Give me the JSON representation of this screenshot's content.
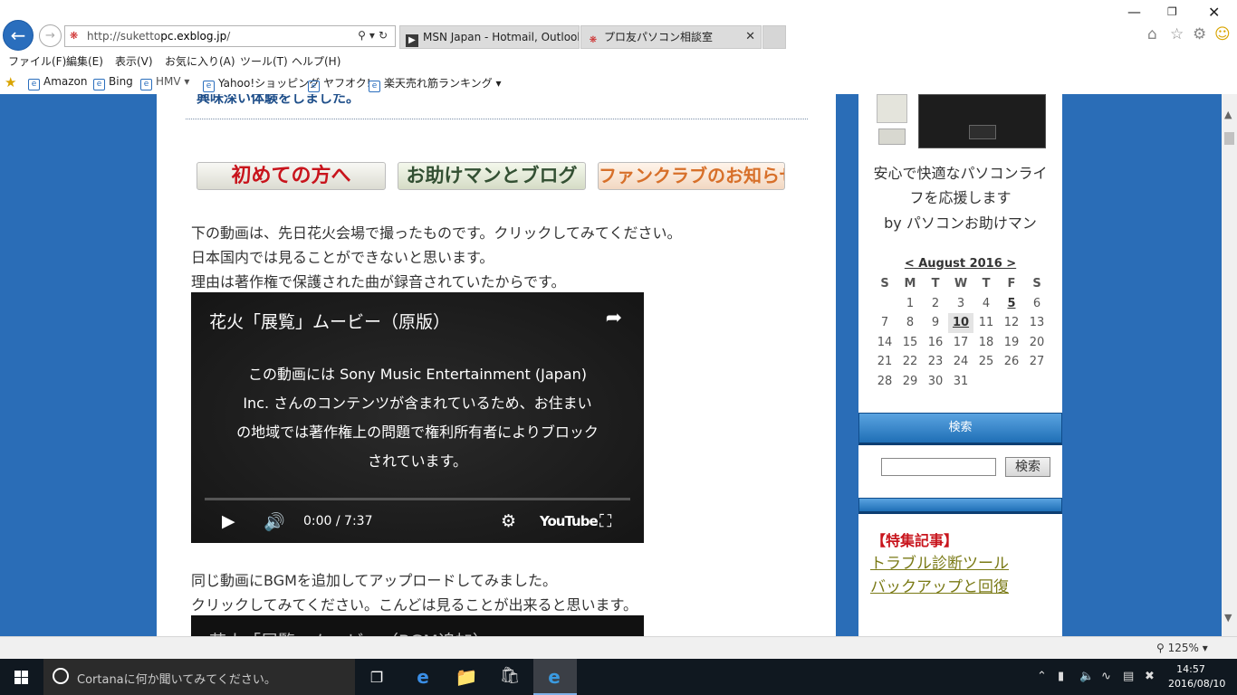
{
  "browser": {
    "url_prefix": "http://suketto",
    "url_domain": "pc.exblog.jp",
    "url_suffix": "/",
    "tabs": [
      {
        "label": "MSN Japan - Hotmail, Outlook...",
        "icon": "msn-icon"
      },
      {
        "label": "プロ友パソコン相談室",
        "icon": "site-icon"
      }
    ],
    "menu": [
      "ファイル(F)",
      "編集(E)",
      "表示(V)",
      "お気に入り(A)",
      "ツール(T)",
      "ヘルプ(H)"
    ],
    "favorites": [
      "Amazon",
      "Bing",
      "HMV",
      "Yahoo!ショッピング",
      "ヤフオク!",
      "楽天売れ筋ランキング"
    ]
  },
  "main": {
    "cut_heading": "興味深い体験をしました。",
    "banners": [
      "初めての方へ",
      "お助けマンとブログ",
      "ファンクラブのお知らせ"
    ],
    "paragraph1": [
      "下の動画は、先日花火会場で撮ったものです。クリックしてみてください。",
      "日本国内では見ることができないと思います。",
      "理由は著作権で保護された曲が録音されていたからです。"
    ],
    "video1": {
      "title": "花火「展覧」ムービー（原版）",
      "message": "この動画には Sony Music Entertainment (Japan) Inc. さんのコンテンツが含まれているため、お住まいの地域では著作権上の問題で権利所有者によりブロックされています。",
      "time": "0:00 / 7:37",
      "logo": "YouTube"
    },
    "paragraph2": [
      "同じ動画にBGMを追加してアップロードしてみました。",
      "クリックしてみてください。こんどは見ることが出来ると思います。"
    ],
    "video2": {
      "title": "花火「展覧」ムービー（BGM追加）"
    }
  },
  "sidebar": {
    "tagline": [
      "安心で快適なパソコンライ",
      "フを応援します",
      "by パソコンお助けマン"
    ],
    "calendar": {
      "title": "< August 2016 >",
      "headers": [
        "S",
        "M",
        "T",
        "W",
        "T",
        "F",
        "S"
      ],
      "weeks": [
        [
          "",
          "1",
          "2",
          "3",
          "4",
          "5",
          "6"
        ],
        [
          "7",
          "8",
          "9",
          "10",
          "11",
          "12",
          "13"
        ],
        [
          "14",
          "15",
          "16",
          "17",
          "18",
          "19",
          "20"
        ],
        [
          "21",
          "22",
          "23",
          "24",
          "25",
          "26",
          "27"
        ],
        [
          "28",
          "29",
          "30",
          "31",
          "",
          "",
          ""
        ]
      ],
      "linked_days": [
        "5"
      ],
      "today": "10"
    },
    "search_heading": "検索",
    "search_button": "検索",
    "featured_heading": "【特集記事】",
    "featured_links": [
      "トラブル診断ツール",
      "バックアップと回復"
    ]
  },
  "status": {
    "zoom": "125%"
  },
  "taskbar": {
    "cortana_placeholder": "Cortanaに何か聞いてみてください。",
    "time": "14:57",
    "date": "2016/08/10"
  }
}
